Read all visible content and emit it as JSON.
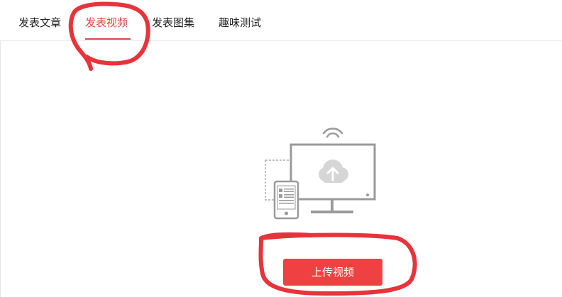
{
  "tabs": [
    {
      "label": "发表文章",
      "active": false
    },
    {
      "label": "发表视频",
      "active": true
    },
    {
      "label": "发表图集",
      "active": false
    },
    {
      "label": "趣味测试",
      "active": false
    }
  ],
  "upload": {
    "button_label": "上传视频"
  },
  "colors": {
    "accent": "#e04645",
    "button": "#f04142",
    "annotation": "#e8333a",
    "illustration_gray": "#9a9a9a",
    "cloud": "#d6d6d6"
  },
  "icons": {
    "wifi": "wifi-icon",
    "monitor": "monitor-icon",
    "cloud_upload": "cloud-upload-icon",
    "phone": "phone-icon"
  }
}
